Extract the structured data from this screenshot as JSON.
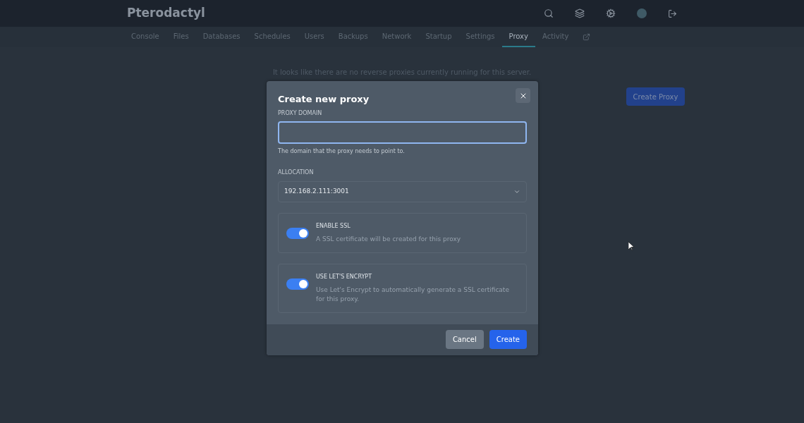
{
  "header": {
    "brand": "Pterodactyl"
  },
  "nav": [
    {
      "label": "Console",
      "selected": false
    },
    {
      "label": "Files",
      "selected": false
    },
    {
      "label": "Databases",
      "selected": false
    },
    {
      "label": "Schedules",
      "selected": false
    },
    {
      "label": "Users",
      "selected": false
    },
    {
      "label": "Backups",
      "selected": false
    },
    {
      "label": "Network",
      "selected": false
    },
    {
      "label": "Startup",
      "selected": false
    },
    {
      "label": "Settings",
      "selected": false
    },
    {
      "label": "Proxy",
      "selected": true
    },
    {
      "label": "Activity",
      "selected": false
    }
  ],
  "page": {
    "empty_message": "It looks like there are no reverse proxies currently running for this server.",
    "create_button": "Create Proxy"
  },
  "modal": {
    "title": "Create new proxy",
    "domain": {
      "label": "PROXY DOMAIN",
      "help": "The domain that the proxy needs to point to."
    },
    "allocation": {
      "label": "ALLOCATION",
      "value": "192.168.2.111:3001"
    },
    "options": [
      {
        "title": "ENABLE SSL",
        "description": "A SSL certificate will be created for this proxy",
        "on": true
      },
      {
        "title": "USE LET'S ENCRYPT",
        "description": "Use Let's Encrypt to automatically generate a SSL certificate for this proxy.",
        "on": true
      }
    ],
    "buttons": {
      "cancel": "Cancel",
      "create": "Create"
    }
  }
}
